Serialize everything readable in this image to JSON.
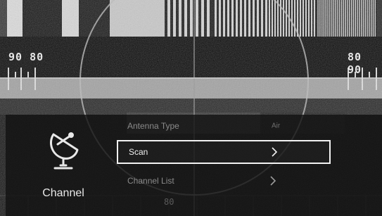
{
  "test_pattern": {
    "scale_left": "90 80",
    "scale_right": "80 90",
    "bottom_mark": "80"
  },
  "sidebar": {
    "category_label": "Channel",
    "category_icon": "satellite-dish-icon"
  },
  "menu": {
    "items": [
      {
        "label": "Antenna Type",
        "value": "Air",
        "state": "dimmed"
      },
      {
        "label": "Scan",
        "value": "",
        "state": "selected",
        "icon": "chevron-right-icon"
      },
      {
        "label": "Channel List",
        "value": "",
        "state": "dimmed",
        "icon": "chevron-right-icon"
      }
    ]
  },
  "colors": {
    "highlight_border": "#f2f2f2",
    "panel_bg": "#121212",
    "text_active": "#f0f0f0",
    "text_dimmed": "#8a8a8a"
  }
}
